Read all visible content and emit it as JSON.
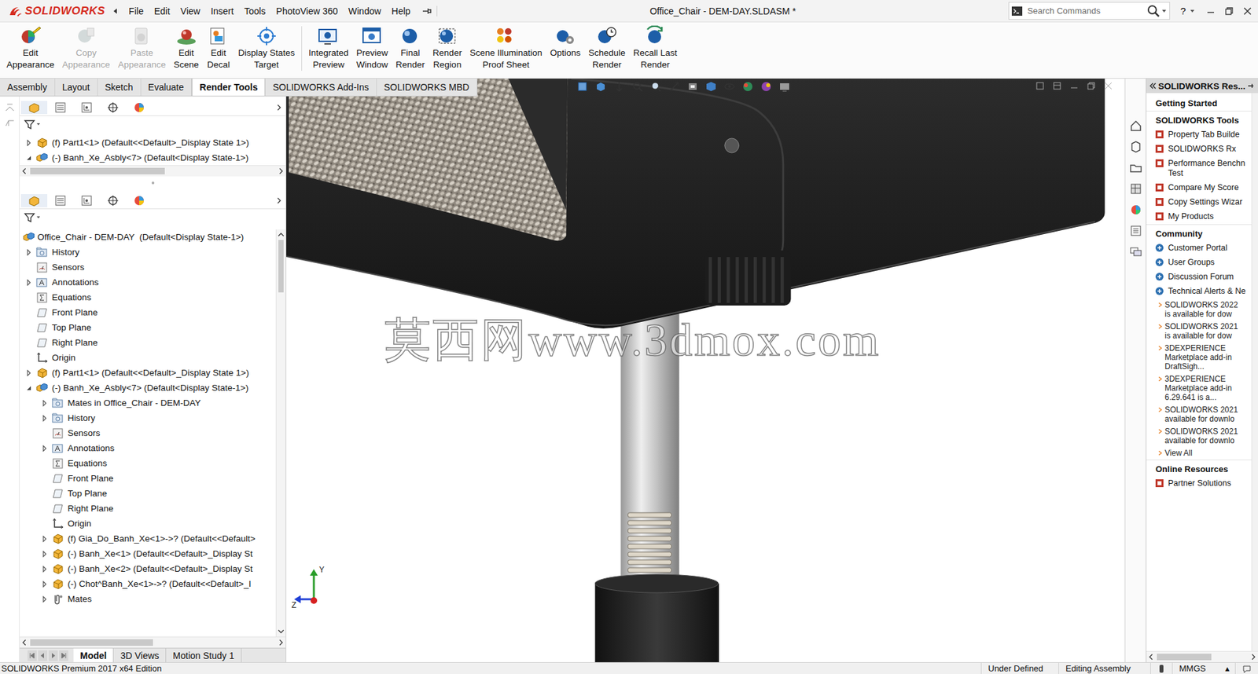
{
  "app": {
    "logo": "SOLIDWORKS"
  },
  "window": {
    "title": "Office_Chair - DEM-DAY.SLDASM *"
  },
  "menu": [
    "File",
    "Edit",
    "View",
    "Insert",
    "Tools",
    "PhotoView 360",
    "Window",
    "Help"
  ],
  "search": {
    "placeholder": "Search Commands"
  },
  "help": "?",
  "ribbon": [
    {
      "lines": [
        "Edit",
        "Appearance"
      ],
      "disabled": false
    },
    {
      "lines": [
        "Copy",
        "Appearance"
      ],
      "disabled": true
    },
    {
      "lines": [
        "Paste",
        "Appearance"
      ],
      "disabled": true
    },
    {
      "lines": [
        "Edit",
        "Scene"
      ],
      "disabled": false
    },
    {
      "lines": [
        "Edit",
        "Decal"
      ],
      "disabled": false
    },
    {
      "lines": [
        "Display States",
        "Target"
      ],
      "disabled": false
    },
    {
      "lines": [
        "Integrated",
        "Preview"
      ],
      "disabled": false
    },
    {
      "lines": [
        "Preview",
        "Window"
      ],
      "disabled": false
    },
    {
      "lines": [
        "Final",
        "Render"
      ],
      "disabled": false
    },
    {
      "lines": [
        "Render",
        "Region"
      ],
      "disabled": false
    },
    {
      "lines": [
        "Scene Illumination",
        "Proof Sheet"
      ],
      "disabled": false
    },
    {
      "lines": [
        "Options"
      ],
      "disabled": false
    },
    {
      "lines": [
        "Schedule",
        "Render"
      ],
      "disabled": false
    },
    {
      "lines": [
        "Recall Last",
        "Render"
      ],
      "disabled": false
    }
  ],
  "command_tabs": [
    {
      "label": "Assembly",
      "selected": false
    },
    {
      "label": "Layout",
      "selected": false
    },
    {
      "label": "Sketch",
      "selected": false
    },
    {
      "label": "Evaluate",
      "selected": false
    },
    {
      "label": "Render Tools",
      "selected": true
    },
    {
      "label": "SOLIDWORKS Add-Ins",
      "selected": false
    },
    {
      "label": "SOLIDWORKS MBD",
      "selected": false
    }
  ],
  "mini_tree": {
    "items": [
      {
        "text": "(f) Part1<1> (Default<<Default>_Display State 1>)",
        "kind": "part",
        "expandable": true,
        "expanded": false
      },
      {
        "text": "(-) Banh_Xe_Asbly<7> (Default<Display State-1>)",
        "kind": "assembly",
        "expandable": true,
        "expanded": true
      }
    ]
  },
  "tree": {
    "root": {
      "text": "Office_Chair - DEM-DAY  (Default<Display State-1>)",
      "kind": "assembly"
    },
    "items": [
      {
        "text": "History",
        "kind": "history",
        "expandable": true,
        "expanded": false
      },
      {
        "text": "Sensors",
        "kind": "sensor",
        "expandable": false,
        "expanded": false
      },
      {
        "text": "Annotations",
        "kind": "annotation",
        "expandable": true,
        "expanded": false
      },
      {
        "text": "Equations",
        "kind": "equation",
        "expandable": false,
        "expanded": false
      },
      {
        "text": "Front Plane",
        "kind": "plane",
        "expandable": false,
        "expanded": false
      },
      {
        "text": "Top Plane",
        "kind": "plane",
        "expandable": false,
        "expanded": false
      },
      {
        "text": "Right Plane",
        "kind": "plane",
        "expandable": false,
        "expanded": false
      },
      {
        "text": "Origin",
        "kind": "origin",
        "expandable": false,
        "expanded": false
      },
      {
        "text": "(f) Part1<1> (Default<<Default>_Display State 1>)",
        "kind": "part",
        "expandable": true,
        "expanded": false
      },
      {
        "text": "(-) Banh_Xe_Asbly<7> (Default<Display State-1>)",
        "kind": "assembly",
        "expandable": true,
        "expanded": true,
        "children": [
          {
            "text": "Mates in Office_Chair - DEM-DAY",
            "kind": "history",
            "expandable": true,
            "expanded": false
          },
          {
            "text": "History",
            "kind": "history",
            "expandable": true,
            "expanded": false
          },
          {
            "text": "Sensors",
            "kind": "sensor",
            "expandable": false,
            "expanded": false
          },
          {
            "text": "Annotations",
            "kind": "annotation",
            "expandable": true,
            "expanded": false
          },
          {
            "text": "Equations",
            "kind": "equation",
            "expandable": false,
            "expanded": false
          },
          {
            "text": "Front Plane",
            "kind": "plane",
            "expandable": false,
            "expanded": false
          },
          {
            "text": "Top Plane",
            "kind": "plane",
            "expandable": false,
            "expanded": false
          },
          {
            "text": "Right Plane",
            "kind": "plane",
            "expandable": false,
            "expanded": false
          },
          {
            "text": "Origin",
            "kind": "origin",
            "expandable": false,
            "expanded": false
          },
          {
            "text": "(f) Gia_Do_Banh_Xe<1>->? (Default<<Default>",
            "kind": "part",
            "expandable": true,
            "expanded": false
          },
          {
            "text": "(-) Banh_Xe<1> (Default<<Default>_Display St",
            "kind": "part",
            "expandable": true,
            "expanded": false
          },
          {
            "text": "(-) Banh_Xe<2> (Default<<Default>_Display St",
            "kind": "part",
            "expandable": true,
            "expanded": false
          },
          {
            "text": "(-) Chot^Banh_Xe<1>->? (Default<<Default>_I",
            "kind": "part",
            "expandable": true,
            "expanded": false
          },
          {
            "text": "Mates",
            "kind": "mates",
            "expandable": true,
            "expanded": false
          }
        ]
      }
    ]
  },
  "bottom_tabs": [
    {
      "label": "Model",
      "selected": true
    },
    {
      "label": "3D Views",
      "selected": false
    },
    {
      "label": "Motion Study 1",
      "selected": false
    }
  ],
  "viewport": {
    "watermark": "莫西网www.3dmox.com",
    "axis_y": "Y",
    "axis_z": "Z"
  },
  "task_pane": {
    "title": "SOLIDWORKS Res...",
    "sections": [
      {
        "heading": "Getting Started",
        "items": [],
        "news": []
      },
      {
        "heading": "SOLIDWORKS Tools",
        "items": [
          {
            "lines": [
              "Property Tab Builde"
            ]
          },
          {
            "lines": [
              "SOLIDWORKS Rx"
            ]
          },
          {
            "lines": [
              "Performance Benchn",
              "Test"
            ]
          },
          {
            "lines": [
              "Compare My Score"
            ]
          },
          {
            "lines": [
              "Copy Settings Wizar"
            ]
          },
          {
            "lines": [
              "My Products"
            ]
          }
        ],
        "news": []
      },
      {
        "heading": "Community",
        "items": [
          {
            "lines": [
              "Customer Portal"
            ]
          },
          {
            "lines": [
              "User Groups"
            ]
          },
          {
            "lines": [
              "Discussion Forum"
            ]
          },
          {
            "lines": [
              "Technical Alerts & Ne"
            ]
          }
        ],
        "news": [
          {
            "lines": [
              "SOLIDWORKS 2022",
              "is available for dow"
            ]
          },
          {
            "lines": [
              "SOLIDWORKS 2021",
              "is available for dow"
            ]
          },
          {
            "lines": [
              "3DEXPERIENCE",
              "Marketplace add-in",
              "DraftSigh..."
            ]
          },
          {
            "lines": [
              "3DEXPERIENCE",
              "Marketplace add-in",
              "6.29.641 is a..."
            ]
          },
          {
            "lines": [
              "SOLIDWORKS 2021",
              "available for downlo"
            ]
          },
          {
            "lines": [
              "SOLIDWORKS 2021",
              "available for downlo"
            ]
          },
          {
            "lines": [
              "View All"
            ]
          }
        ]
      },
      {
        "heading": "Online Resources",
        "items": [
          {
            "lines": [
              "Partner Solutions"
            ]
          }
        ],
        "news": []
      }
    ]
  },
  "status_bar": {
    "edition": "SOLIDWORKS Premium 2017 x64 Edition",
    "state": "Under Defined",
    "mode": "Editing Assembly",
    "units": "MMGS",
    "units_arrow": "▴"
  }
}
